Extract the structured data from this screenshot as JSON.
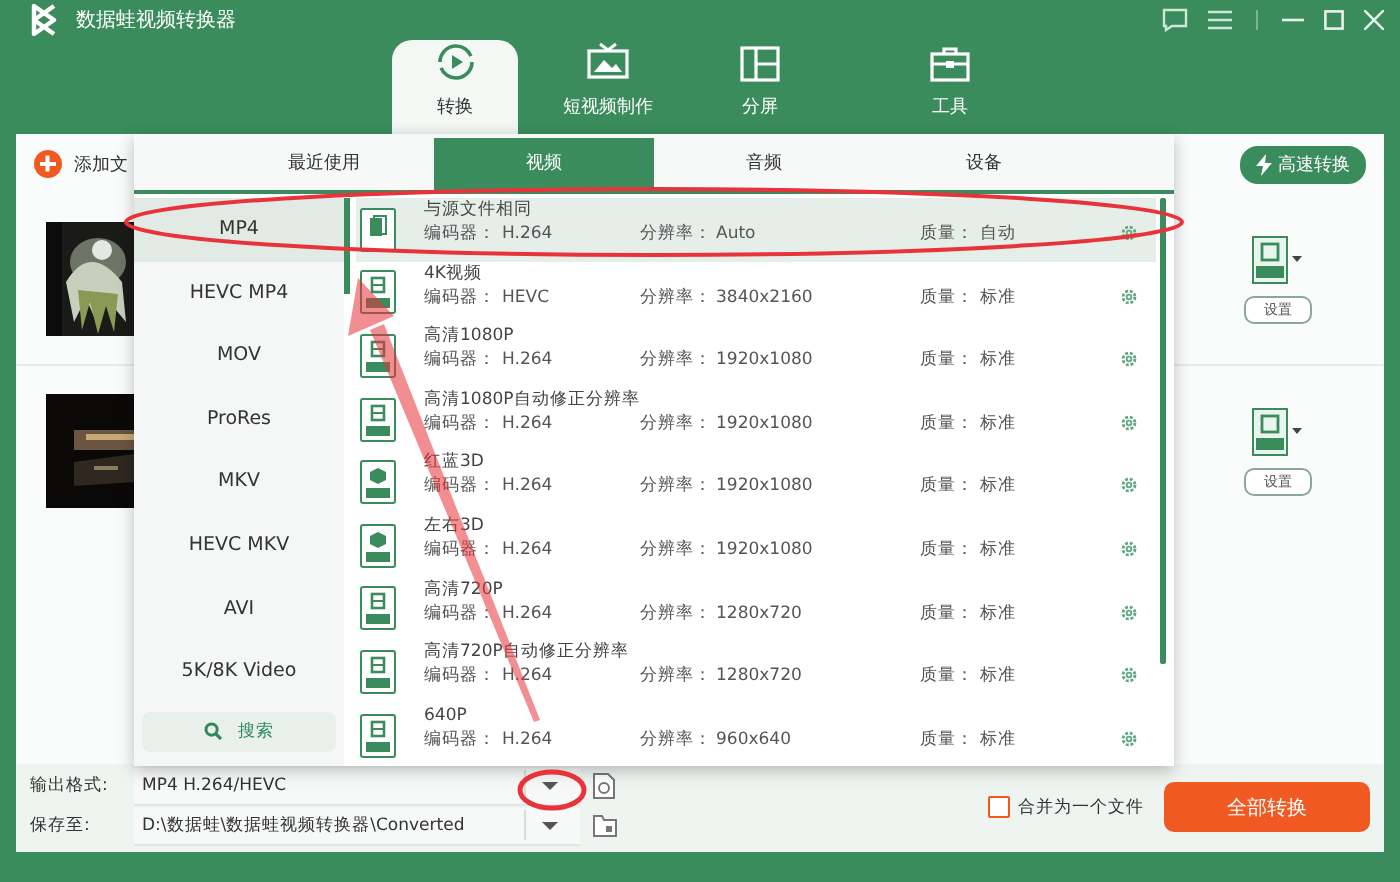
{
  "window": {
    "title": "数据蛙视频转换器"
  },
  "main_tabs": [
    {
      "label": "转换",
      "selected": true
    },
    {
      "label": "短视频制作",
      "selected": false
    },
    {
      "label": "分屏",
      "selected": false
    },
    {
      "label": "工具",
      "selected": false
    }
  ],
  "toolbar": {
    "add_files": "添加文",
    "fast_convert": "高速转换"
  },
  "files": [
    {
      "settings": "设置"
    },
    {
      "settings": "设置"
    }
  ],
  "format_popup": {
    "tabs": [
      {
        "label": "最近使用",
        "selected": false
      },
      {
        "label": "视频",
        "selected": true
      },
      {
        "label": "音频",
        "selected": false
      },
      {
        "label": "设备",
        "selected": false
      }
    ],
    "categories": [
      {
        "label": "MP4",
        "selected": true
      },
      {
        "label": "HEVC MP4",
        "selected": false
      },
      {
        "label": "MOV",
        "selected": false
      },
      {
        "label": "ProRes",
        "selected": false
      },
      {
        "label": "MKV",
        "selected": false
      },
      {
        "label": "HEVC MKV",
        "selected": false
      },
      {
        "label": "AVI",
        "selected": false
      },
      {
        "label": "5K/8K Video",
        "selected": false
      }
    ],
    "search": "搜索",
    "presets": [
      {
        "name": "与源文件相同",
        "encoder_label": "编码器：",
        "encoder": "H.264",
        "resolution_label": "分辨率：",
        "resolution": "Auto",
        "quality_label": "质量：",
        "quality": "自动",
        "selected": true
      },
      {
        "name": "4K视频",
        "encoder_label": "编码器：",
        "encoder": "HEVC",
        "resolution_label": "分辨率：",
        "resolution": "3840x2160",
        "quality_label": "质量：",
        "quality": "标准",
        "selected": false
      },
      {
        "name": "高清1080P",
        "encoder_label": "编码器：",
        "encoder": "H.264",
        "resolution_label": "分辨率：",
        "resolution": "1920x1080",
        "quality_label": "质量：",
        "quality": "标准",
        "selected": false
      },
      {
        "name": "高清1080P自动修正分辨率",
        "encoder_label": "编码器：",
        "encoder": "H.264",
        "resolution_label": "分辨率：",
        "resolution": "1920x1080",
        "quality_label": "质量：",
        "quality": "标准",
        "selected": false
      },
      {
        "name": "红蓝3D",
        "encoder_label": "编码器：",
        "encoder": "H.264",
        "resolution_label": "分辨率：",
        "resolution": "1920x1080",
        "quality_label": "质量：",
        "quality": "标准",
        "selected": false
      },
      {
        "name": "左右3D",
        "encoder_label": "编码器：",
        "encoder": "H.264",
        "resolution_label": "分辨率：",
        "resolution": "1920x1080",
        "quality_label": "质量：",
        "quality": "标准",
        "selected": false
      },
      {
        "name": "高清720P",
        "encoder_label": "编码器：",
        "encoder": "H.264",
        "resolution_label": "分辨率：",
        "resolution": "1280x720",
        "quality_label": "质量：",
        "quality": "标准",
        "selected": false
      },
      {
        "name": "高清720P自动修正分辨率",
        "encoder_label": "编码器：",
        "encoder": "H.264",
        "resolution_label": "分辨率：",
        "resolution": "1280x720",
        "quality_label": "质量：",
        "quality": "标准",
        "selected": false
      },
      {
        "name": "640P",
        "encoder_label": "编码器：",
        "encoder": "H.264",
        "resolution_label": "分辨率：",
        "resolution": "960x640",
        "quality_label": "质量：",
        "quality": "标准",
        "selected": false
      }
    ]
  },
  "output": {
    "format_label": "输出格式:",
    "format": "MP4 H.264/HEVC",
    "save_label": "保存至:",
    "save_path": "D:\\数据蛙\\数据蛙视频转换器\\Converted"
  },
  "merge": {
    "label": "合并为一个文件",
    "checked": false
  },
  "convert_all": "全部转换"
}
